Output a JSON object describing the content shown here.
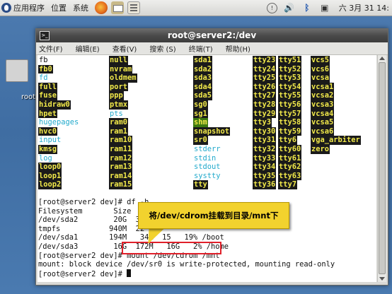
{
  "panel": {
    "menus": [
      "应用程序",
      "位置",
      "系统"
    ],
    "clock": "六 3月 31 14:"
  },
  "desktop": {
    "icon_label": "root"
  },
  "window": {
    "title": "root@server2:/dev",
    "menu": [
      "文件(F)",
      "编辑(E)",
      "查看(V)",
      "搜索 (S)",
      "终端(T)",
      "帮助(H)"
    ]
  },
  "ls_columns": [
    [
      {
        "n": "fb",
        "t": "plain"
      },
      {
        "n": "fb0",
        "t": "dev"
      },
      {
        "n": "fd",
        "t": "link"
      },
      {
        "n": "full",
        "t": "dev"
      },
      {
        "n": "fuse",
        "t": "dev"
      },
      {
        "n": "hidraw0",
        "t": "dev"
      },
      {
        "n": "hpet",
        "t": "dev"
      },
      {
        "n": "hugepages",
        "t": "link"
      },
      {
        "n": "hvc0",
        "t": "dev"
      },
      {
        "n": "input",
        "t": "link"
      },
      {
        "n": "kmsg",
        "t": "dev"
      },
      {
        "n": "log",
        "t": "link"
      },
      {
        "n": "loop0",
        "t": "dev"
      },
      {
        "n": "loop1",
        "t": "dev"
      },
      {
        "n": "loop2",
        "t": "dev"
      }
    ],
    [
      {
        "n": "null",
        "t": "dev"
      },
      {
        "n": "nvram",
        "t": "dev"
      },
      {
        "n": "oldmem",
        "t": "dev"
      },
      {
        "n": "port",
        "t": "dev"
      },
      {
        "n": "ppp",
        "t": "dev"
      },
      {
        "n": "ptmx",
        "t": "dev"
      },
      {
        "n": "pts",
        "t": "link"
      },
      {
        "n": "ram0",
        "t": "dev"
      },
      {
        "n": "ram1",
        "t": "dev"
      },
      {
        "n": "ram10",
        "t": "dev"
      },
      {
        "n": "ram11",
        "t": "dev"
      },
      {
        "n": "ram12",
        "t": "dev"
      },
      {
        "n": "ram13",
        "t": "dev"
      },
      {
        "n": "ram14",
        "t": "dev"
      },
      {
        "n": "ram15",
        "t": "dev"
      }
    ],
    [
      {
        "n": "sda1",
        "t": "dev"
      },
      {
        "n": "sda2",
        "t": "dev"
      },
      {
        "n": "sda3",
        "t": "dev"
      },
      {
        "n": "sda4",
        "t": "dev"
      },
      {
        "n": "sda5",
        "t": "dev"
      },
      {
        "n": "sg0",
        "t": "dev"
      },
      {
        "n": "sg1",
        "t": "dev"
      },
      {
        "n": "shm",
        "t": "exec"
      },
      {
        "n": "snapshot",
        "t": "dev"
      },
      {
        "n": "sr0",
        "t": "dev"
      },
      {
        "n": "stderr",
        "t": "link"
      },
      {
        "n": "stdin",
        "t": "link"
      },
      {
        "n": "stdout",
        "t": "link"
      },
      {
        "n": "systty",
        "t": "link"
      },
      {
        "n": "tty",
        "t": "dev"
      }
    ],
    [
      {
        "n": "tty23",
        "t": "dev"
      },
      {
        "n": "tty24",
        "t": "dev"
      },
      {
        "n": "tty25",
        "t": "dev"
      },
      {
        "n": "tty26",
        "t": "dev"
      },
      {
        "n": "tty27",
        "t": "dev"
      },
      {
        "n": "tty28",
        "t": "dev"
      },
      {
        "n": "tty29",
        "t": "dev"
      },
      {
        "n": "tty3",
        "t": "dev"
      },
      {
        "n": "tty30",
        "t": "dev"
      },
      {
        "n": "tty31",
        "t": "dev"
      },
      {
        "n": "tty32",
        "t": "dev"
      },
      {
        "n": "tty33",
        "t": "dev"
      },
      {
        "n": "tty34",
        "t": "dev"
      },
      {
        "n": "tty35",
        "t": "dev"
      },
      {
        "n": "tty36",
        "t": "dev"
      }
    ],
    [
      {
        "n": "tty51",
        "t": "dev"
      },
      {
        "n": "tty52",
        "t": "dev"
      },
      {
        "n": "tty53",
        "t": "dev"
      },
      {
        "n": "tty54",
        "t": "dev"
      },
      {
        "n": "tty55",
        "t": "dev"
      },
      {
        "n": "tty56",
        "t": "dev"
      },
      {
        "n": "tty57",
        "t": "dev"
      },
      {
        "n": "tty58",
        "t": "dev"
      },
      {
        "n": "tty59",
        "t": "dev"
      },
      {
        "n": "tty6",
        "t": "dev"
      },
      {
        "n": "tty60",
        "t": "dev"
      },
      {
        "n": "tty61",
        "t": "dev"
      },
      {
        "n": "tty62",
        "t": "dev"
      },
      {
        "n": "tty63",
        "t": "dev"
      },
      {
        "n": "tty7",
        "t": "dev"
      }
    ],
    [
      {
        "n": "vcs5",
        "t": "dev"
      },
      {
        "n": "vcs6",
        "t": "dev"
      },
      {
        "n": "vcsa",
        "t": "dev"
      },
      {
        "n": "vcsa1",
        "t": "dev"
      },
      {
        "n": "vcsa2",
        "t": "dev"
      },
      {
        "n": "vcsa3",
        "t": "dev"
      },
      {
        "n": "vcsa4",
        "t": "dev"
      },
      {
        "n": "vcsa5",
        "t": "dev"
      },
      {
        "n": "vcsa6",
        "t": "dev"
      },
      {
        "n": "vga_arbiter",
        "t": "dev"
      },
      {
        "n": "zero",
        "t": "dev"
      }
    ]
  ],
  "lines": [
    "[root@server2 dev]# df -h",
    "Filesystem       Size  Used Avail Use% Mounted on",
    "/dev/sda2        20G  3.",
    "tmpfs           940M  22",
    "/dev/sda1       194M   34M  15   19% /boot",
    "/dev/sda3        16G  172M   16G   2% /home",
    "[root@server2 dev]# mount /dev/cdrom /mnt",
    "mount: block device /dev/sr0 is write-protected, mounting read-only",
    "[root@server2 dev]# "
  ],
  "annotation": "将/dev/cdrom挂载到目录/mnt下"
}
